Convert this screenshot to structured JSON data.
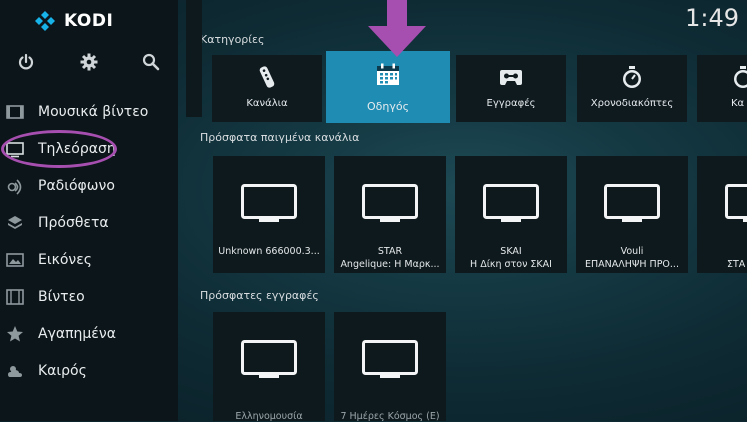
{
  "app": {
    "name": "KODI",
    "clock": "1:49"
  },
  "colors": {
    "accent": "#1f8db3",
    "annotation": "#a64fb0"
  },
  "sidebar": {
    "top_icons": [
      "power-icon",
      "gear-icon",
      "search-icon"
    ],
    "items": [
      {
        "label": "Μουσικά βίντεο",
        "icon": "music-video-icon"
      },
      {
        "label": "Τηλεόραση",
        "icon": "tv-icon"
      },
      {
        "label": "Ραδιόφωνο",
        "icon": "radio-icon"
      },
      {
        "label": "Πρόσθετα",
        "icon": "addons-icon"
      },
      {
        "label": "Εικόνες",
        "icon": "pictures-icon"
      },
      {
        "label": "Βίντεο",
        "icon": "film-icon"
      },
      {
        "label": "Αγαπημένα",
        "icon": "star-icon"
      },
      {
        "label": "Καιρός",
        "icon": "weather-icon"
      }
    ]
  },
  "categories": {
    "title": "Κατηγορίες",
    "items": [
      {
        "label": "Κανάλια",
        "icon": "remote-icon"
      },
      {
        "label": "Οδηγός",
        "icon": "calendar-icon",
        "active": true
      },
      {
        "label": "Εγγραφές",
        "icon": "cassette-icon"
      },
      {
        "label": "Χρονοδιακόπτες",
        "icon": "timer-icon"
      },
      {
        "label": "Κα",
        "icon": "timer-rule-icon"
      }
    ]
  },
  "recent_channels": {
    "title": "Πρόσφατα παιγμένα κανάλια",
    "items": [
      {
        "line1": "Unknown 666000.3...",
        "line2": ""
      },
      {
        "line1": "STAR",
        "line2": "Angelique: Η Μαρκ..."
      },
      {
        "line1": "SKAI",
        "line2": "Η Δίκη στον ΣΚΑΪ"
      },
      {
        "line1": "Vouli",
        "line2": "ΕΠΑΝΑΛΗΨΗ ΠΡΟ..."
      },
      {
        "line1": "",
        "line2": "ΣΤΑ"
      }
    ]
  },
  "recent_recordings": {
    "title": "Πρόσφατες εγγραφές",
    "items": [
      {
        "line1": "Ελληνομουσία"
      },
      {
        "line1": "7 Ημέρες Κόσμος (Ε)"
      }
    ]
  }
}
